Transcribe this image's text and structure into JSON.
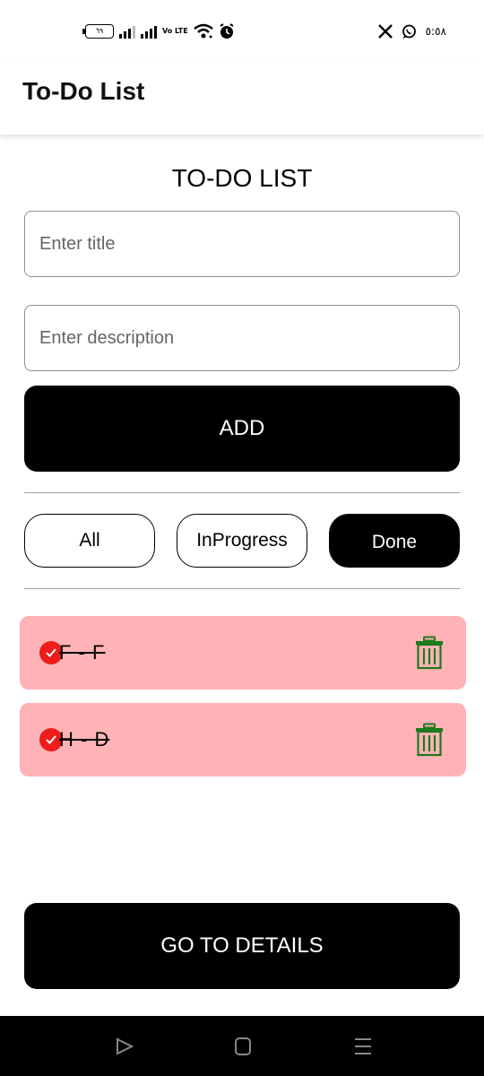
{
  "status_bar": {
    "battery": "٦٩",
    "volte": "Vo LTE",
    "time": "٥:٥٨",
    "icons": [
      "battery-icon",
      "signal-icon",
      "signal-icon",
      "volte-icon",
      "wifi-icon",
      "alarm-icon",
      "x-icon",
      "whatsapp-icon"
    ]
  },
  "app_bar": {
    "title": "To-Do List"
  },
  "main": {
    "heading": "TO-DO LIST",
    "title_input": {
      "value": "",
      "placeholder": "Enter title"
    },
    "description_input": {
      "value": "",
      "placeholder": "Enter description"
    },
    "add_label": "ADD",
    "filters": [
      {
        "label": "All",
        "selected": false
      },
      {
        "label": "InProgress",
        "selected": false
      },
      {
        "label": "Done",
        "selected": true
      }
    ],
    "tasks": [
      {
        "title": "F",
        "description": "F",
        "text": "F - F",
        "done": true
      },
      {
        "title": "H",
        "description": "D",
        "text": "H - D",
        "done": true
      }
    ],
    "details_label": "GO TO DETAILS"
  },
  "colors": {
    "task_background": "#ffb3b6",
    "check_color": "#ee1c1c",
    "delete_icon_color": "#1e7a1e",
    "button_background": "#000000"
  },
  "nav_bar": {
    "icons": [
      "back-icon",
      "home-icon",
      "recents-icon"
    ]
  }
}
